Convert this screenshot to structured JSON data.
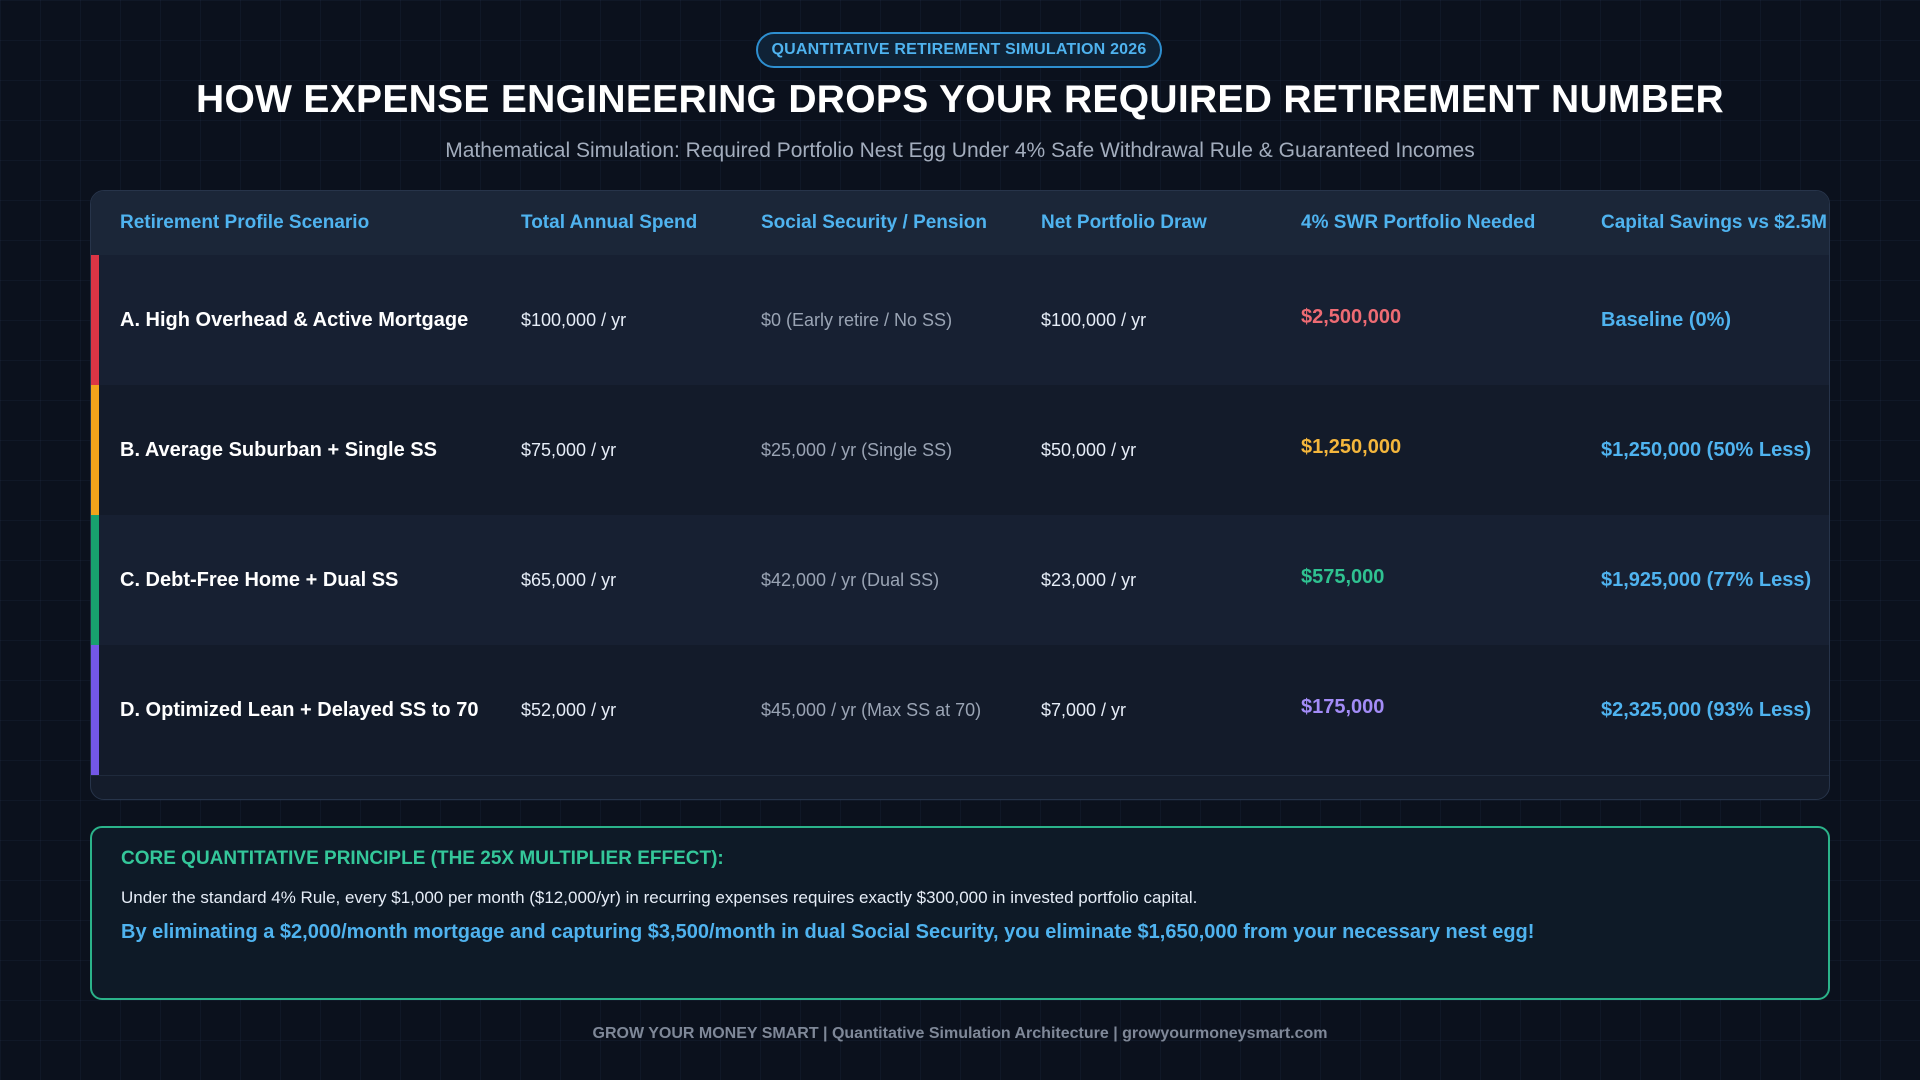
{
  "badge": "QUANTITATIVE RETIREMENT SIMULATION 2026",
  "title": "HOW EXPENSE ENGINEERING DROPS YOUR REQUIRED RETIREMENT NUMBER",
  "subtitle": "Mathematical Simulation: Required Portfolio Nest Egg Under 4% Safe Withdrawal Rule & Guaranteed Incomes",
  "table": {
    "headers": [
      "Retirement Profile Scenario",
      "Total Annual Spend",
      "Social Security / Pension",
      "Net Portfolio Draw",
      "4% SWR Portfolio Needed",
      "Capital Savings vs $2.5M"
    ],
    "rows": [
      {
        "scenario": "A. High Overhead & Active Mortgage",
        "spend": "$100,000 / yr",
        "ss": "$0 (Early retire / No SS)",
        "draw": "$100,000 / yr",
        "needed": "$2,500,000",
        "savings": "Baseline (0%)",
        "accent_color": "#dc3545",
        "needed_color": "#ee6b73"
      },
      {
        "scenario": "B. Average Suburban + Single SS",
        "spend": "$75,000 / yr",
        "ss": "$25,000 / yr (Single SS)",
        "draw": "$50,000 / yr",
        "needed": "$1,250,000",
        "savings": "$1,250,000 (50% Less)",
        "accent_color": "#f2a31b",
        "needed_color": "#f4b63c"
      },
      {
        "scenario": "C. Debt-Free Home + Dual SS",
        "spend": "$65,000 / yr",
        "ss": "$42,000 / yr (Dual SS)",
        "draw": "$23,000 / yr",
        "needed": "$575,000",
        "savings": "$1,925,000 (77% Less)",
        "accent_color": "#18a06e",
        "needed_color": "#2fc291"
      },
      {
        "scenario": "D. Optimized Lean + Delayed SS to 70",
        "spend": "$52,000 / yr",
        "ss": "$45,000 / yr (Max SS at 70)",
        "draw": "$7,000 / yr",
        "needed": "$175,000",
        "savings": "$2,325,000 (93% Less)",
        "accent_color": "#7357e6",
        "needed_color": "#a38cf7"
      }
    ]
  },
  "principle": {
    "heading": "CORE QUANTITATIVE PRINCIPLE (THE 25X MULTIPLIER EFFECT):",
    "line1": "Under the standard 4% Rule, every $1,000 per month ($12,000/yr) in recurring expenses requires exactly $300,000 in invested portfolio capital.",
    "line2": "By eliminating a $2,000/month mortgage and capturing $3,500/month in dual Social Security, you eliminate $1,650,000 from your necessary nest egg!"
  },
  "footer": "GROW YOUR MONEY SMART | Quantitative Simulation Architecture | growyourmoneysmart.com"
}
